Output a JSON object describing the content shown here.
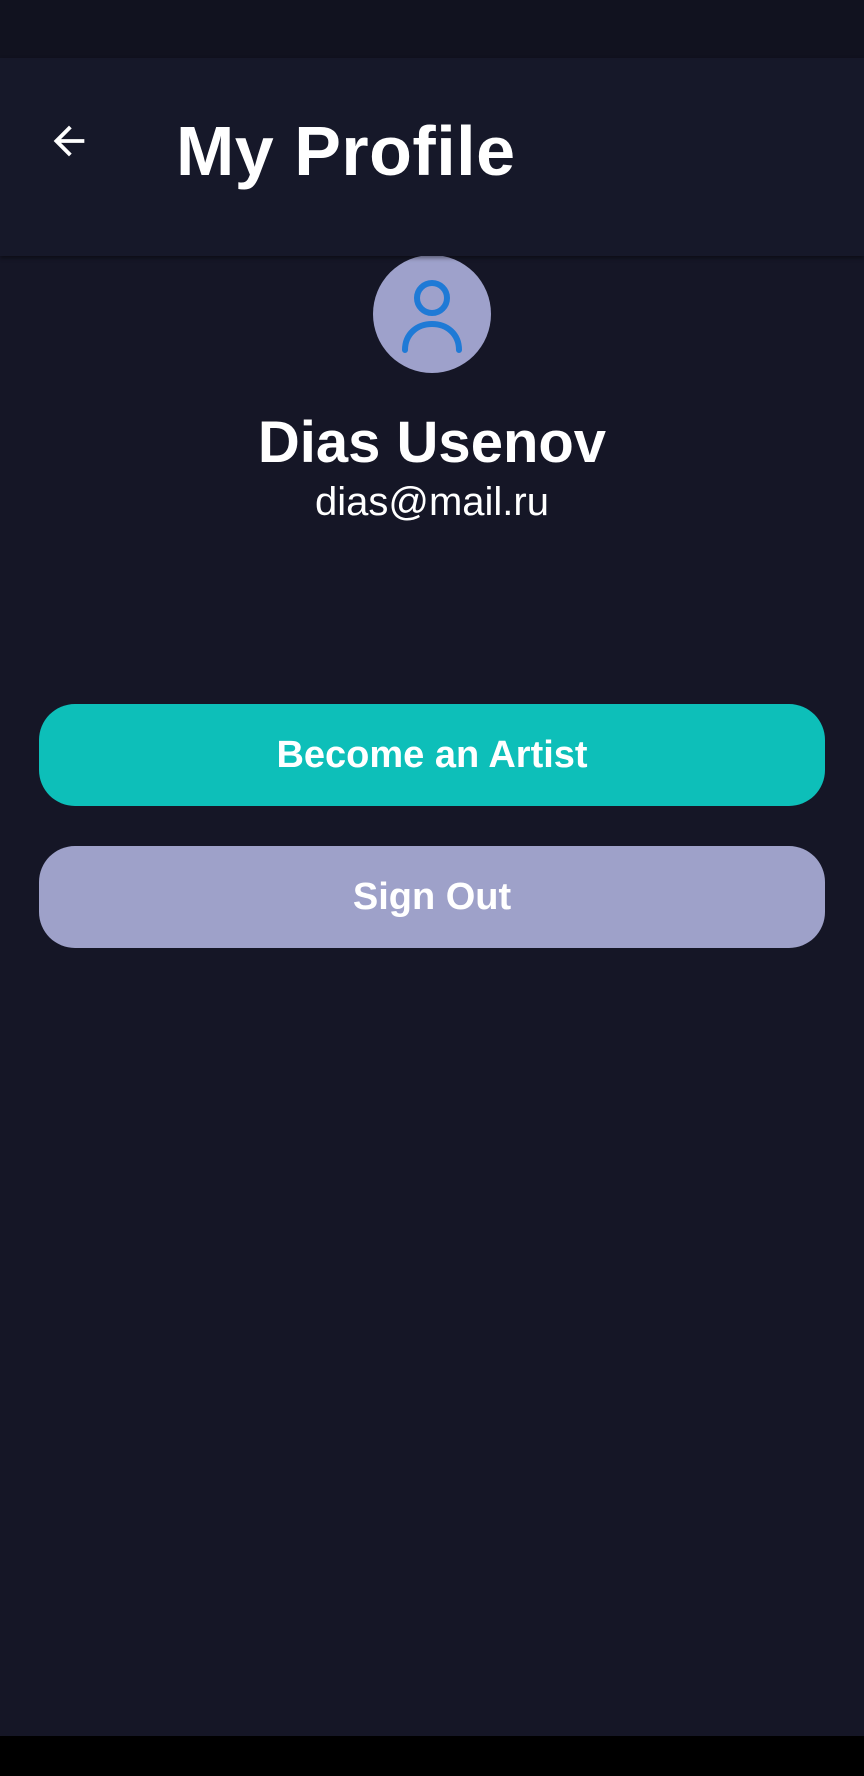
{
  "header": {
    "title": "My Profile",
    "back_icon": "arrow-left-icon"
  },
  "profile": {
    "avatar_icon": "person-icon",
    "name": "Dias Usenov",
    "email": "dias@mail.ru"
  },
  "actions": {
    "become_artist_label": "Become an Artist",
    "sign_out_label": "Sign Out"
  },
  "colors": {
    "background": "#151626",
    "app_bar": "#161829",
    "accent_teal": "#0dbfb9",
    "muted_lavender": "#9ea1c9",
    "avatar_icon": "#1f7ad6"
  }
}
